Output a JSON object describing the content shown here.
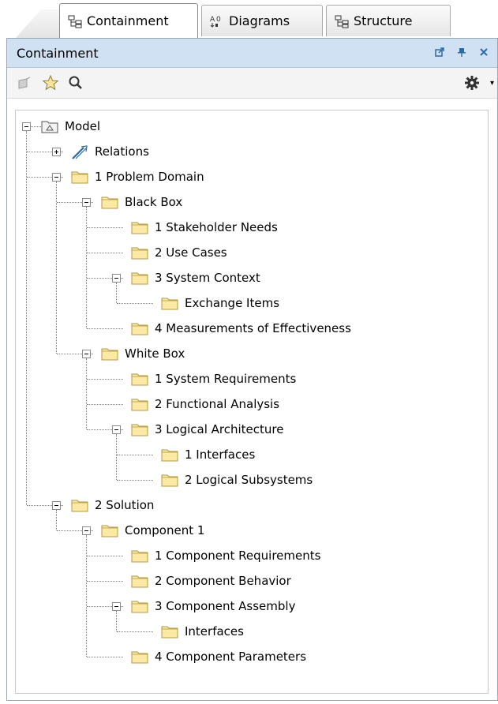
{
  "tabs": [
    {
      "label": "Containment",
      "icon": "containment-icon",
      "active": true
    },
    {
      "label": "Diagrams",
      "icon": "diagrams-icon",
      "active": false
    },
    {
      "label": "Structure",
      "icon": "structure-icon",
      "active": false
    }
  ],
  "panel": {
    "title": "Containment",
    "controls": [
      "undock-icon",
      "pin-icon",
      "close-icon"
    ]
  },
  "toolbar": {
    "left": [
      "open-spec-icon",
      "favorite-star-icon",
      "search-icon"
    ],
    "right": [
      "settings-gear-icon",
      "dropdown-arrow-icon"
    ]
  },
  "tree": [
    {
      "label": "Model",
      "level": 0,
      "icon": "model-package-icon",
      "expanded": true
    },
    {
      "label": "Relations",
      "level": 1,
      "icon": "relations-icon",
      "expanded": false
    },
    {
      "label": "1 Problem Domain",
      "level": 1,
      "icon": "folder-icon",
      "expanded": true
    },
    {
      "label": "Black Box",
      "level": 2,
      "icon": "folder-icon",
      "expanded": true
    },
    {
      "label": "1 Stakeholder Needs",
      "level": 3,
      "icon": "folder-icon"
    },
    {
      "label": "2 Use Cases",
      "level": 3,
      "icon": "folder-icon"
    },
    {
      "label": "3 System Context",
      "level": 3,
      "icon": "folder-icon",
      "expanded": true
    },
    {
      "label": "Exchange Items",
      "level": 4,
      "icon": "folder-icon"
    },
    {
      "label": "4 Measurements of Effectiveness",
      "level": 3,
      "icon": "folder-icon"
    },
    {
      "label": "White Box",
      "level": 2,
      "icon": "folder-icon",
      "expanded": true
    },
    {
      "label": "1 System Requirements",
      "level": 3,
      "icon": "folder-icon"
    },
    {
      "label": "2 Functional Analysis",
      "level": 3,
      "icon": "folder-icon"
    },
    {
      "label": "3 Logical Architecture",
      "level": 3,
      "icon": "folder-icon",
      "expanded": true
    },
    {
      "label": "1 Interfaces",
      "level": 4,
      "icon": "folder-icon"
    },
    {
      "label": "2 Logical Subsystems",
      "level": 4,
      "icon": "folder-icon"
    },
    {
      "label": "2 Solution",
      "level": 1,
      "icon": "folder-icon",
      "expanded": true
    },
    {
      "label": "Component 1",
      "level": 2,
      "icon": "folder-icon",
      "expanded": true
    },
    {
      "label": "1 Component Requirements",
      "level": 3,
      "icon": "folder-icon"
    },
    {
      "label": "2 Component Behavior",
      "level": 3,
      "icon": "folder-icon"
    },
    {
      "label": "3 Component Assembly",
      "level": 3,
      "icon": "folder-icon",
      "expanded": true
    },
    {
      "label": "Interfaces",
      "level": 4,
      "icon": "folder-icon"
    },
    {
      "label": "4 Component Parameters",
      "level": 3,
      "icon": "folder-icon"
    }
  ],
  "colors": {
    "titlebar": "#cfe1f3",
    "folder_fill": "#fbe9a6",
    "folder_stroke": "#b8963d",
    "link_blue": "#2c6ba5"
  }
}
